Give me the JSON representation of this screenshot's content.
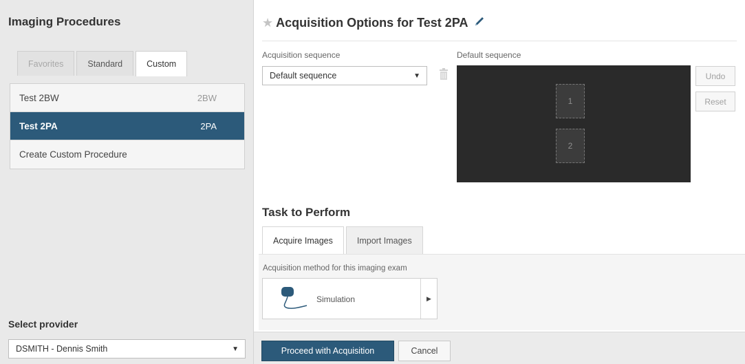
{
  "left_panel": {
    "title": "Imaging Procedures",
    "tabs": [
      {
        "label": "Favorites",
        "state": "disabled"
      },
      {
        "label": "Standard",
        "state": "normal"
      },
      {
        "label": "Custom",
        "state": "active"
      }
    ],
    "procedures": [
      {
        "name": "Test 2BW",
        "code": "2BW",
        "selected": false
      },
      {
        "name": "Test 2PA",
        "code": "2PA",
        "selected": true
      }
    ],
    "create_label": "Create Custom Procedure",
    "provider_label": "Select provider",
    "provider_value": "DSMITH - Dennis Smith"
  },
  "main": {
    "title": "Acquisition Options for Test 2PA",
    "icons": {
      "star": "star-icon",
      "edit": "pencil-icon",
      "delete": "trash-icon",
      "method": "mouse-icon",
      "expand": "chevron-right-icon"
    },
    "acquisition_sequence_label": "Acquisition sequence",
    "acquisition_sequence_value": "Default sequence",
    "default_sequence_label": "Default sequence",
    "sequence_slots": [
      "1",
      "2"
    ],
    "undo_label": "Undo",
    "reset_label": "Reset",
    "task_title": "Task to Perform",
    "task_tabs": [
      "Acquire Images",
      "Import Images"
    ],
    "method_label": "Acquisition method for this imaging exam",
    "method_value": "Simulation",
    "proceed_label": "Proceed with Acquisition",
    "cancel_label": "Cancel"
  },
  "colors": {
    "accent": "#2c5a7a",
    "canvas": "#2a2a2a",
    "sidebar_bg": "#e9e9e9"
  }
}
